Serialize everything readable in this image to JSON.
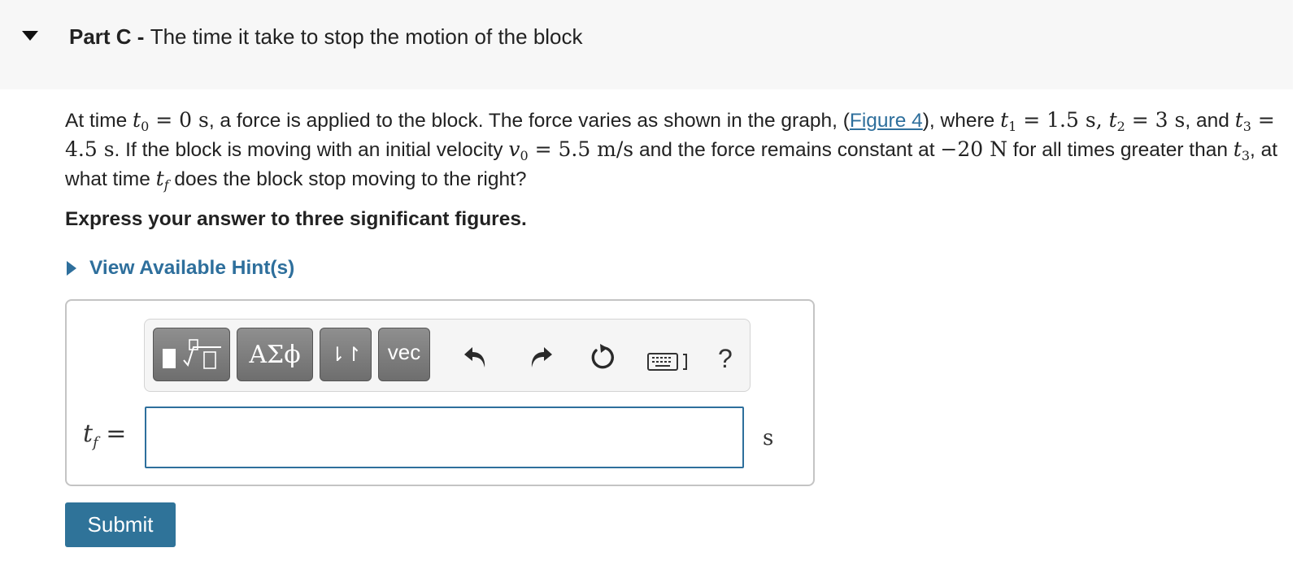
{
  "part": {
    "prefix": "Part C - ",
    "title": "The time it take to stop the motion of the block"
  },
  "problem": {
    "s1": "At time ",
    "t0": "t",
    "t0_sub": "0",
    "t0_val": " = 0 s",
    "s2": ", a force is applied to the block. The force varies as shown in the graph, (",
    "figure_link": "Figure 4",
    "s3": "), where ",
    "t1": "t",
    "t1_sub": "1",
    "t1_val": " = 1.5 s",
    "comma1": ", ",
    "t2": "t",
    "t2_sub": "2",
    "t2_val": " = 3 s",
    "s4": ", and ",
    "t3": "t",
    "t3_sub": "3",
    "t3_val": " = 4.5 s",
    "s5": ". If the block is moving with an initial velocity ",
    "v0": "v",
    "v0_sub": "0",
    "v0_val": " = 5.5 m/s",
    "s6": " and the force remains constant at ",
    "force_val": "−20 N",
    "s7": " for all times greater than ",
    "t3b": "t",
    "t3b_sub": "3",
    "s8": ", at what time ",
    "tf": "t",
    "tf_sub": "f",
    "s9": " does the block stop moving to the right?"
  },
  "instruction": "Express your answer to three significant figures.",
  "hint_label": "View Available Hint(s)",
  "toolbar": {
    "greek_label": "ΑΣϕ",
    "arrows_label": "⇂↾",
    "vec_label": "vec",
    "help_label": "?"
  },
  "answer": {
    "var_name": "t",
    "var_sub": "f",
    "equals": " =",
    "value": "",
    "unit": "s"
  },
  "submit_label": "Submit",
  "colors": {
    "link": "#2e6f9c",
    "submit_bg": "#2f7399",
    "header_bg": "#f7f7f7",
    "toolbar_button": "#7a7a7a"
  },
  "icons": [
    "collapse-triangle-icon",
    "expand-triangle-icon",
    "templates-icon",
    "undo-icon",
    "redo-icon",
    "reset-icon",
    "keyboard-icon"
  ]
}
